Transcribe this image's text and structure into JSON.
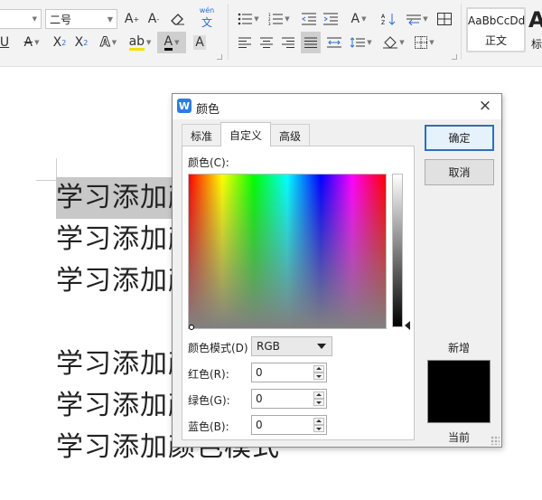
{
  "ribbon": {
    "font_size": "二号",
    "wen_label": "wén",
    "style_sample": "AaBbCcDd",
    "style_name": "正文",
    "style_big": "A",
    "style_big_sub": "标"
  },
  "document": {
    "lines": [
      "学习添加颜色模式",
      "学习添加颜色模式",
      "学习添加颜色模式",
      "学习添加颜色模式",
      "学习添加颜色模式",
      "学习添加颜色模式"
    ]
  },
  "dialog": {
    "title": "颜色",
    "app_icon": "W",
    "close": "×",
    "tabs": [
      "标准",
      "自定义",
      "高级"
    ],
    "active_tab": "自定义",
    "color_label": "颜色(C):",
    "mode_label": "颜色模式(D)",
    "mode_value": "RGB",
    "red_label": "红色(R):",
    "green_label": "绿色(G):",
    "blue_label": "蓝色(B):",
    "red_value": "0",
    "green_value": "0",
    "blue_value": "0",
    "ok": "确定",
    "cancel": "取消",
    "new_label": "新增",
    "current_label": "当前",
    "swatch_color": "#000000"
  }
}
